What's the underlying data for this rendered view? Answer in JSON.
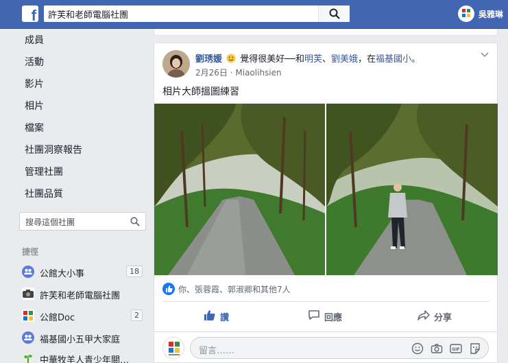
{
  "topbar": {
    "logo_letter": "f",
    "search_value": "許芙和老師電腦社團",
    "user_name": "吳雅琳"
  },
  "leftnav": {
    "items": [
      {
        "label": "成員"
      },
      {
        "label": "活動"
      },
      {
        "label": "影片"
      },
      {
        "label": "相片"
      },
      {
        "label": "檔案"
      },
      {
        "label": "社團洞察報告"
      },
      {
        "label": "管理社團"
      },
      {
        "label": "社團品質"
      }
    ],
    "group_search_placeholder": "搜尋這個社團",
    "shortcuts_title": "捷徑",
    "shortcuts": [
      {
        "label": "公館大小事",
        "count": "18",
        "icon": "group-icon"
      },
      {
        "label": "許芙和老師電腦社團",
        "count": "",
        "icon": "camera-icon"
      },
      {
        "label": "公館Doc",
        "count": "2",
        "icon": "doc-icon"
      },
      {
        "label": "福基國小五甲大家庭",
        "count": "",
        "icon": "group-icon"
      },
      {
        "label": "中華牧羊人青少年關…",
        "count": "",
        "icon": "plant-icon"
      }
    ]
  },
  "post": {
    "author": "劉琇媛",
    "feeling": "覺得很美好──和",
    "with1": "明芙",
    "sep": "、",
    "with2": "劉美娥",
    "at": "，在",
    "place": "福基國小",
    "end": "。",
    "date": "2月26日",
    "dot": "·",
    "location": "Miaolihsien",
    "text": "相片大師搵圖練習",
    "reactions_text": "你、張蓉霞、郭淑卿和其他7人",
    "actions": {
      "like": "讚",
      "comment": "回應",
      "share": "分享"
    },
    "comment_placeholder": "留言……"
  },
  "colors": {
    "brand": "#4267b2",
    "link": "#385898",
    "like_blue": "#1877f2"
  }
}
